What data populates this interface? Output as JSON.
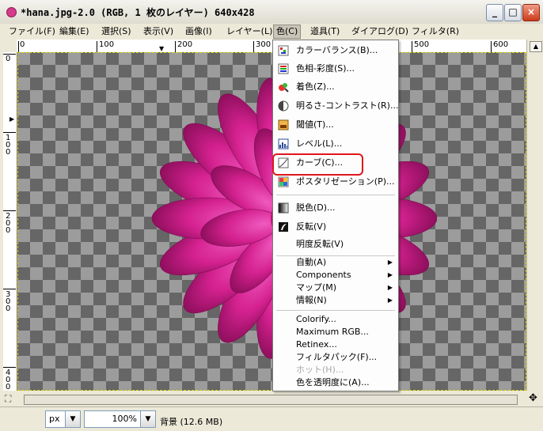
{
  "window": {
    "title": "*hana.jpg-2.0 (RGB, 1 枚のレイヤー) 640x428",
    "controls": [
      "_",
      "□",
      "×"
    ]
  },
  "menubar": [
    "ファイル(F)",
    "編集(E)",
    "選択(S)",
    "表示(V)",
    "画像(I)",
    "レイヤー(L)",
    "色(C)",
    "道具(T)",
    "ダイアログ(D)",
    "フィルタ(R)"
  ],
  "ruler": {
    "h_labels": [
      "0",
      "100",
      "200",
      "300",
      "500",
      "600"
    ],
    "v_labels": [
      "0",
      "100",
      "200",
      "300",
      "400"
    ]
  },
  "color_menu": {
    "items": [
      {
        "label": "カラーバランス(B)...",
        "icon": "color-balance-icon"
      },
      {
        "label": "色相-彩度(S)...",
        "icon": "hue-saturation-icon"
      },
      {
        "label": "着色(Z)...",
        "icon": "colorize-icon"
      },
      {
        "label": "明るさ-コントラスト(R)...",
        "icon": "brightness-contrast-icon"
      },
      {
        "label": "閾値(T)...",
        "icon": "threshold-icon"
      },
      {
        "label": "レベル(L)...",
        "icon": "levels-icon"
      },
      {
        "label": "カーブ(C)...",
        "icon": "curves-icon"
      },
      {
        "label": "ポスタリゼーション(P)...",
        "icon": "posterize-icon"
      }
    ],
    "items2": [
      {
        "label": "脱色(D)...",
        "icon": "desaturate-icon"
      },
      {
        "label": "反転(V)",
        "icon": "invert-icon"
      },
      {
        "label": "明度反転(V)",
        "icon": ""
      }
    ],
    "submenus": [
      "自動(A)",
      "Components",
      "マップ(M)",
      "情報(N)"
    ],
    "plugins": [
      "Colorify...",
      "Maximum RGB...",
      "Retinex...",
      "フィルタパック(F)...",
      "ホット(H)...",
      "色を透明度に(A)..."
    ],
    "disabled": "ホット(H)...",
    "highlighted": "カーブ(C)..."
  },
  "statusbar": {
    "unit": "px",
    "zoom": "100%",
    "info": "背景 (12.6 MB)"
  },
  "colors": {
    "accent_highlight": "#e0161b",
    "flower": "#d4218f"
  }
}
